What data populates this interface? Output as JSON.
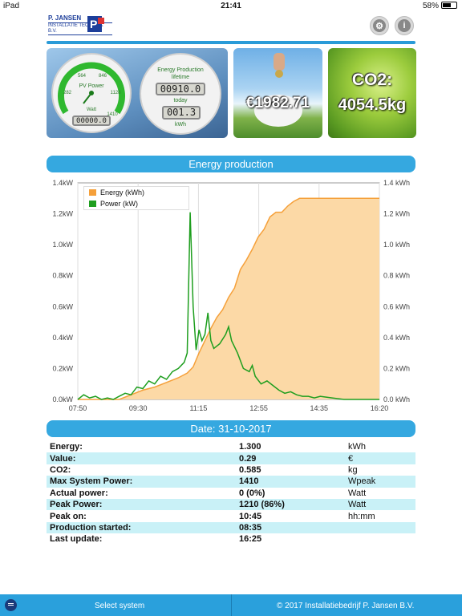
{
  "status": {
    "device": "iPad",
    "time": "21:41",
    "battery": "58%"
  },
  "logo": {
    "line1": "P. JANSEN",
    "line2": "INSTALLATIE TECHNIEK B.V."
  },
  "header": {
    "settings_icon": "gear-icon",
    "info_icon": "info-icon"
  },
  "meters": {
    "pv_title": "PV Power",
    "pv_scale": [
      "282",
      "564",
      "846",
      "1128",
      "1410"
    ],
    "pv_unit": "Watt",
    "pv_value": "00000.0",
    "prod_title": "Energy Production",
    "prod_lifetime_label": "lifetime",
    "prod_lifetime_value": "00910.0",
    "prod_today_label": "today",
    "prod_today_value": "001.3",
    "prod_unit": "kWh"
  },
  "money": {
    "value": "€1982.71"
  },
  "co2": {
    "label": "CO2:",
    "value": "4054.5kg"
  },
  "chart_banner": "Energy production",
  "chart_data": {
    "type": "area",
    "x_ticks": [
      "07:50",
      "09:30",
      "11:15",
      "12:55",
      "14:35",
      "16:20"
    ],
    "y_left_ticks": [
      "0.0kW",
      "0.2kW",
      "0.4kW",
      "0.6kW",
      "0.8kW",
      "1.0kW",
      "1.2kW",
      "1.4kW"
    ],
    "y_right_ticks": [
      "0.0 kWh",
      "0.2 kWh",
      "0.4 kWh",
      "0.6 kWh",
      "0.8 kWh",
      "1.0 kWh",
      "1.2 kWh",
      "1.4 kWh"
    ],
    "ylim": [
      0,
      1.4
    ],
    "xlim_minutes": [
      470,
      980
    ],
    "legend": [
      {
        "name": "Energy (kWh)",
        "color": "#f5a03a"
      },
      {
        "name": "Power (kW)",
        "color": "#1e9e1e"
      }
    ],
    "series": [
      {
        "name": "Energy (kWh)",
        "color": "#f5a03a",
        "fill": "#fcd9a6",
        "points": [
          [
            470,
            0
          ],
          [
            540,
            0
          ],
          [
            560,
            0.03
          ],
          [
            580,
            0.06
          ],
          [
            600,
            0.08
          ],
          [
            620,
            0.11
          ],
          [
            640,
            0.14
          ],
          [
            655,
            0.17
          ],
          [
            665,
            0.21
          ],
          [
            675,
            0.3
          ],
          [
            685,
            0.38
          ],
          [
            695,
            0.46
          ],
          [
            705,
            0.53
          ],
          [
            715,
            0.58
          ],
          [
            725,
            0.66
          ],
          [
            735,
            0.72
          ],
          [
            745,
            0.84
          ],
          [
            755,
            0.9
          ],
          [
            765,
            0.97
          ],
          [
            775,
            1.05
          ],
          [
            785,
            1.1
          ],
          [
            795,
            1.18
          ],
          [
            805,
            1.21
          ],
          [
            815,
            1.21
          ],
          [
            825,
            1.25
          ],
          [
            835,
            1.28
          ],
          [
            845,
            1.3
          ],
          [
            980,
            1.3
          ]
        ]
      },
      {
        "name": "Power (kW)",
        "color": "#1e9e1e",
        "points": [
          [
            470,
            0.0
          ],
          [
            480,
            0.03
          ],
          [
            490,
            0.01
          ],
          [
            500,
            0.02
          ],
          [
            510,
            0.0
          ],
          [
            520,
            0.01
          ],
          [
            530,
            0.0
          ],
          [
            540,
            0.02
          ],
          [
            550,
            0.04
          ],
          [
            560,
            0.03
          ],
          [
            570,
            0.08
          ],
          [
            580,
            0.07
          ],
          [
            590,
            0.12
          ],
          [
            600,
            0.1
          ],
          [
            610,
            0.15
          ],
          [
            620,
            0.13
          ],
          [
            630,
            0.18
          ],
          [
            640,
            0.2
          ],
          [
            650,
            0.24
          ],
          [
            655,
            0.3
          ],
          [
            660,
            1.21
          ],
          [
            665,
            0.6
          ],
          [
            670,
            0.32
          ],
          [
            675,
            0.45
          ],
          [
            680,
            0.38
          ],
          [
            685,
            0.42
          ],
          [
            690,
            0.56
          ],
          [
            695,
            0.38
          ],
          [
            700,
            0.33
          ],
          [
            710,
            0.36
          ],
          [
            720,
            0.42
          ],
          [
            725,
            0.47
          ],
          [
            730,
            0.38
          ],
          [
            740,
            0.3
          ],
          [
            750,
            0.2
          ],
          [
            760,
            0.18
          ],
          [
            765,
            0.22
          ],
          [
            770,
            0.15
          ],
          [
            780,
            0.1
          ],
          [
            790,
            0.12
          ],
          [
            800,
            0.09
          ],
          [
            810,
            0.06
          ],
          [
            820,
            0.04
          ],
          [
            830,
            0.05
          ],
          [
            840,
            0.03
          ],
          [
            850,
            0.02
          ],
          [
            860,
            0.02
          ],
          [
            870,
            0.01
          ],
          [
            880,
            0.02
          ],
          [
            900,
            0.01
          ],
          [
            920,
            0.0
          ],
          [
            980,
            0.0
          ]
        ]
      }
    ]
  },
  "date_banner": "Date: 31-10-2017",
  "info_rows": [
    {
      "label": "Energy:",
      "value": "1.300",
      "unit": "kWh"
    },
    {
      "label": "Value:",
      "value": "0.29",
      "unit": "€"
    },
    {
      "label": "CO2:",
      "value": "0.585",
      "unit": "kg"
    },
    {
      "label": "Max System Power:",
      "value": "1410",
      "unit": "Wpeak"
    },
    {
      "label": "Actual power:",
      "value": "0 (0%)",
      "unit": "Watt"
    },
    {
      "label": "Peak Power:",
      "value": "1210 (86%)",
      "unit": "Watt"
    },
    {
      "label": "Peak on:",
      "value": "10:45",
      "unit": "hh:mm"
    },
    {
      "label": "Production started:",
      "value": "08:35",
      "unit": ""
    },
    {
      "label": "Last update:",
      "value": "16:25",
      "unit": ""
    }
  ],
  "footer": {
    "select_label": "Select system",
    "copyright": "© 2017 Installatiebedrijf P. Jansen B.V."
  }
}
